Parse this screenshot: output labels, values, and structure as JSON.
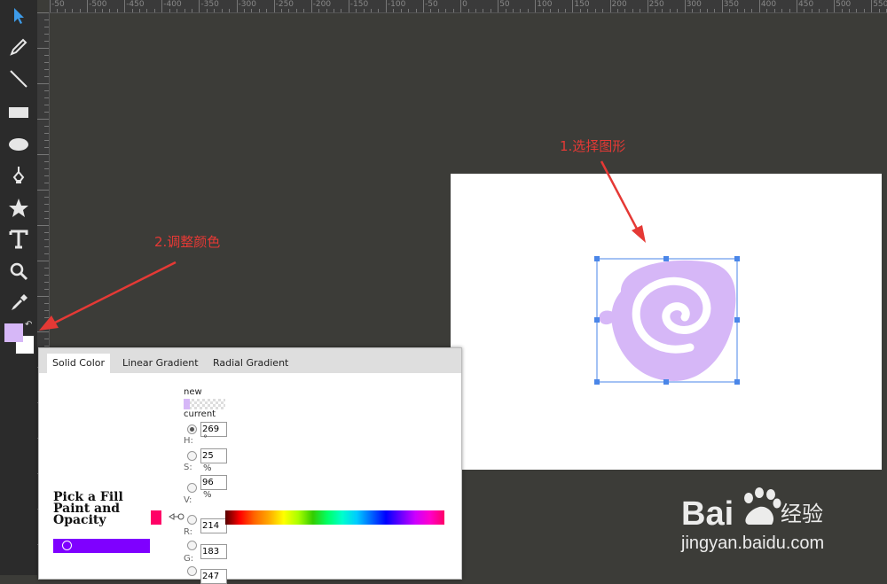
{
  "toolbar": {
    "tools": [
      "select-icon",
      "pencil-icon",
      "line-icon",
      "rectangle-icon",
      "ellipse-icon",
      "pen-icon",
      "star-icon",
      "text-icon",
      "zoom-icon",
      "eyedropper-icon"
    ],
    "fill_color": "#d6b7f7",
    "stroke_color": "#ffffff"
  },
  "ruler": {
    "top_labels": [
      "-50",
      "-500",
      "-450",
      "-400",
      "-350",
      "-300",
      "-250",
      "-200",
      "-150",
      "-100",
      "-50",
      "0",
      "50",
      "100",
      "150",
      "200",
      "250",
      "300",
      "350",
      "400",
      "450",
      "500",
      "550"
    ]
  },
  "annotations": {
    "step1": "1.选择图形",
    "step2": "2.调整颜色",
    "color": "#e53935"
  },
  "shape": {
    "fill": "#d6b7f7",
    "selection_color": "#4a86e8"
  },
  "picker": {
    "tabs": [
      "Solid Color",
      "Linear Gradient",
      "Radial Gradient"
    ],
    "active_tab": "Solid Color",
    "title_lines": [
      "Pick a Fill",
      "Paint and",
      "Opacity"
    ],
    "new_label": "new",
    "current_label": "current",
    "fields": {
      "h": {
        "label": "H:",
        "value": "269",
        "unit": "°"
      },
      "s": {
        "label": "S:",
        "value": "25",
        "unit": "%"
      },
      "v": {
        "label": "V:",
        "value": "96",
        "unit": "%"
      },
      "r": {
        "label": "R:",
        "value": "214"
      },
      "g": {
        "label": "G:",
        "value": "183"
      },
      "b": {
        "value": "247"
      }
    },
    "hue_slider_color": "#7f00ff",
    "preview_color": "#d6b7f7"
  },
  "watermark": {
    "brand": "Bai",
    "brand_suffix": "经验",
    "url": "jingyan.baidu.com"
  }
}
